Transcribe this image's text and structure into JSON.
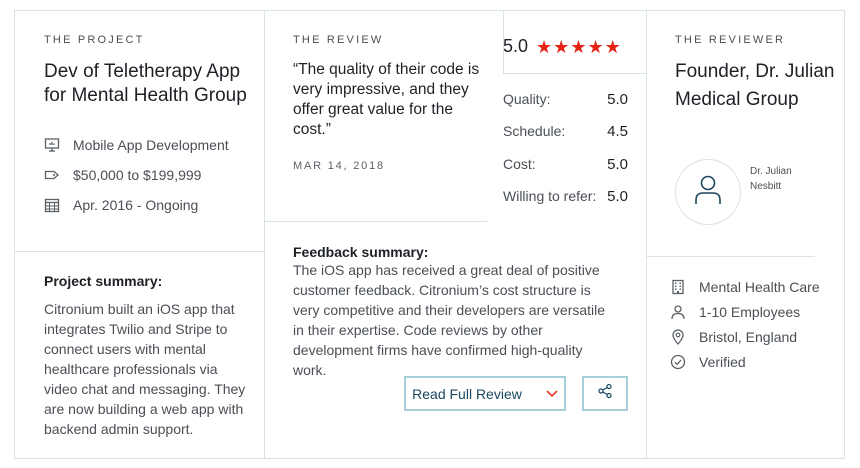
{
  "project": {
    "eyebrow": "THE PROJECT",
    "title": "Dev of Teletherapy App for Mental Health Group",
    "meta": [
      {
        "icon": "monitor-icon",
        "text": "Mobile App Development"
      },
      {
        "icon": "price-tag-icon",
        "text": "$50,000 to $199,999"
      },
      {
        "icon": "calendar-icon",
        "text": "Apr. 2016 - Ongoing"
      }
    ],
    "summary_heading": "Project summary:",
    "summary_text": "Citronium built an iOS app that integrates Twilio and Stripe to connect users with mental healthcare professionals via video chat and messaging. They are now building a web app with backend admin support."
  },
  "review": {
    "eyebrow": "THE REVIEW",
    "quote": "“The quality of their code is very impressive, and they offer great value for the cost.”",
    "date": "MAR 14, 2018",
    "overall_score": "5.0",
    "stars": 5,
    "star_color": "#e62415",
    "ratings": [
      {
        "label": "Quality:",
        "value": "5.0"
      },
      {
        "label": "Schedule:",
        "value": "4.5"
      },
      {
        "label": "Cost:",
        "value": "5.0"
      },
      {
        "label": "Willing to refer:",
        "value": "5.0"
      }
    ],
    "feedback_heading": "Feedback summary:",
    "feedback_text": "The iOS app has received a great deal of positive customer feedback. Citronium’s cost structure is very competitive and their developers are versatile in their expertise. Code reviews by other development firms have confirmed high-quality work.",
    "read_button": "Read Full Review",
    "share_icon": "share-icon"
  },
  "reviewer": {
    "eyebrow": "THE REVIEWER",
    "title": "Founder, Dr. Julian Medical Group",
    "name": "Dr. Julian Nesbitt",
    "meta": [
      {
        "icon": "building-icon",
        "text": "Mental Health Care"
      },
      {
        "icon": "person-icon",
        "text": "1-10 Employees"
      },
      {
        "icon": "location-pin-icon",
        "text": "Bristol, England"
      },
      {
        "icon": "check-circle-icon",
        "text": "Verified"
      }
    ]
  },
  "colors": {
    "accent_red": "#e62415",
    "button_border": "#a7cfd9",
    "button_text": "#1a4660",
    "divider": "#d8e3e8"
  }
}
